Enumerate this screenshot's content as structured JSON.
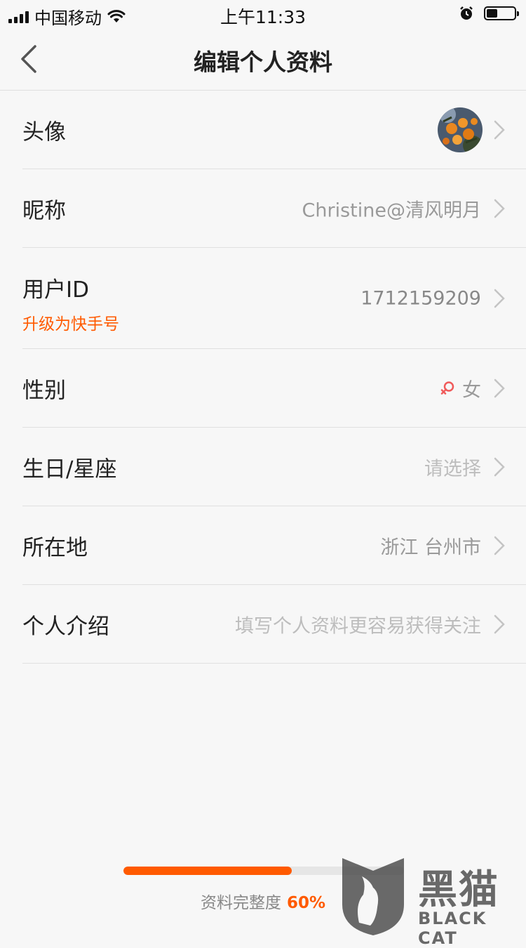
{
  "status_bar": {
    "carrier": "中国移动",
    "time": "上午11:33",
    "battery_level": 0.45
  },
  "nav": {
    "title": "编辑个人资料"
  },
  "rows": {
    "avatar": {
      "label": "头像"
    },
    "nickname": {
      "label": "昵称",
      "value": "Christine@清风明月"
    },
    "user_id": {
      "label": "用户ID",
      "sub_link": "升级为快手号",
      "value": "1712159209"
    },
    "gender": {
      "label": "性别",
      "value": "女",
      "icon": "female-icon"
    },
    "birthday": {
      "label": "生日/星座",
      "value": "请选择"
    },
    "location": {
      "label": "所在地",
      "value": "浙江 台州市"
    },
    "bio": {
      "label": "个人介绍",
      "value": "填写个人资料更容易获得关注"
    }
  },
  "completion": {
    "label": "资料完整度",
    "percent_text": "60%",
    "fraction": 0.6
  },
  "watermark": {
    "cn": "黑猫",
    "en": "BLACK CAT"
  },
  "colors": {
    "accent": "#ff5a00",
    "background": "#f7f7f7",
    "divider": "#e0e0e0"
  }
}
